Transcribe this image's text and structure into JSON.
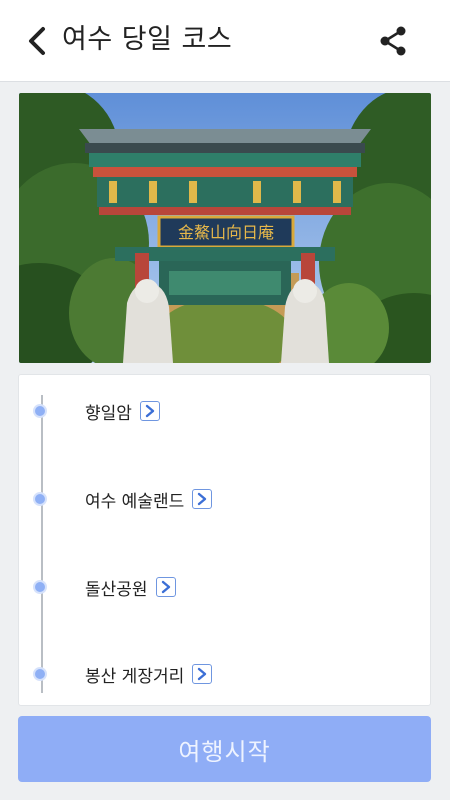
{
  "header": {
    "title": "여수 당일 코스",
    "back_icon": "chevron-left-icon",
    "share_icon": "share-icon"
  },
  "hero": {
    "description_icon": "temple-gate-photo",
    "signboard_text": "金鰲山向日庵"
  },
  "course": {
    "stops": [
      {
        "label": "향일암",
        "icon": "chevron-right-icon"
      },
      {
        "label": "여수 예술랜드",
        "icon": "chevron-right-icon"
      },
      {
        "label": "돌산공원",
        "icon": "chevron-right-icon"
      },
      {
        "label": "봉산 게장거리",
        "icon": "chevron-right-icon"
      }
    ]
  },
  "footer": {
    "start_label": "여행시작"
  },
  "colors": {
    "accent": "#8fadf6",
    "dot": "#8fb0f5",
    "arrow_border": "#6f96e0"
  }
}
